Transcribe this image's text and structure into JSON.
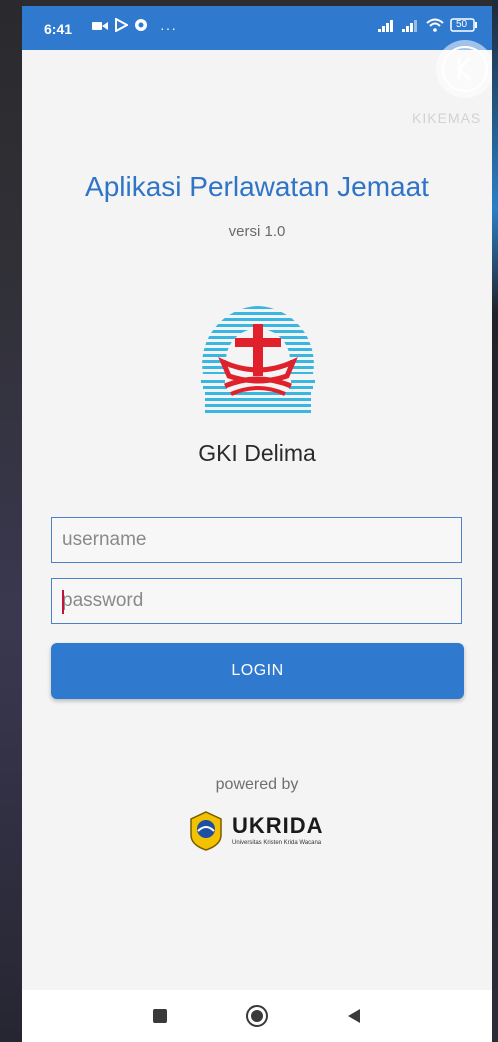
{
  "status_bar": {
    "time": "6:41",
    "battery": "50",
    "more": "···"
  },
  "watermark": {
    "label": "KIKEMAS"
  },
  "app": {
    "title": "Aplikasi Perlawatan Jemaat",
    "version": "versi 1.0",
    "church_name": "GKI Delima"
  },
  "form": {
    "username_placeholder": "username",
    "password_placeholder": "password",
    "login_label": "LOGIN"
  },
  "footer": {
    "powered_by": "powered by",
    "sponsor_name": "UKRIDA",
    "sponsor_tagline": "Universitas Kristen Krida Wacana"
  },
  "colors": {
    "accent": "#2f79cf",
    "title": "#2f74c6",
    "logo_red": "#e0202a",
    "logo_cyan": "#3ab7e0"
  },
  "icons": {
    "nav_recents": "square-icon",
    "nav_home": "circle-icon",
    "nav_back": "triangle-back-icon"
  }
}
